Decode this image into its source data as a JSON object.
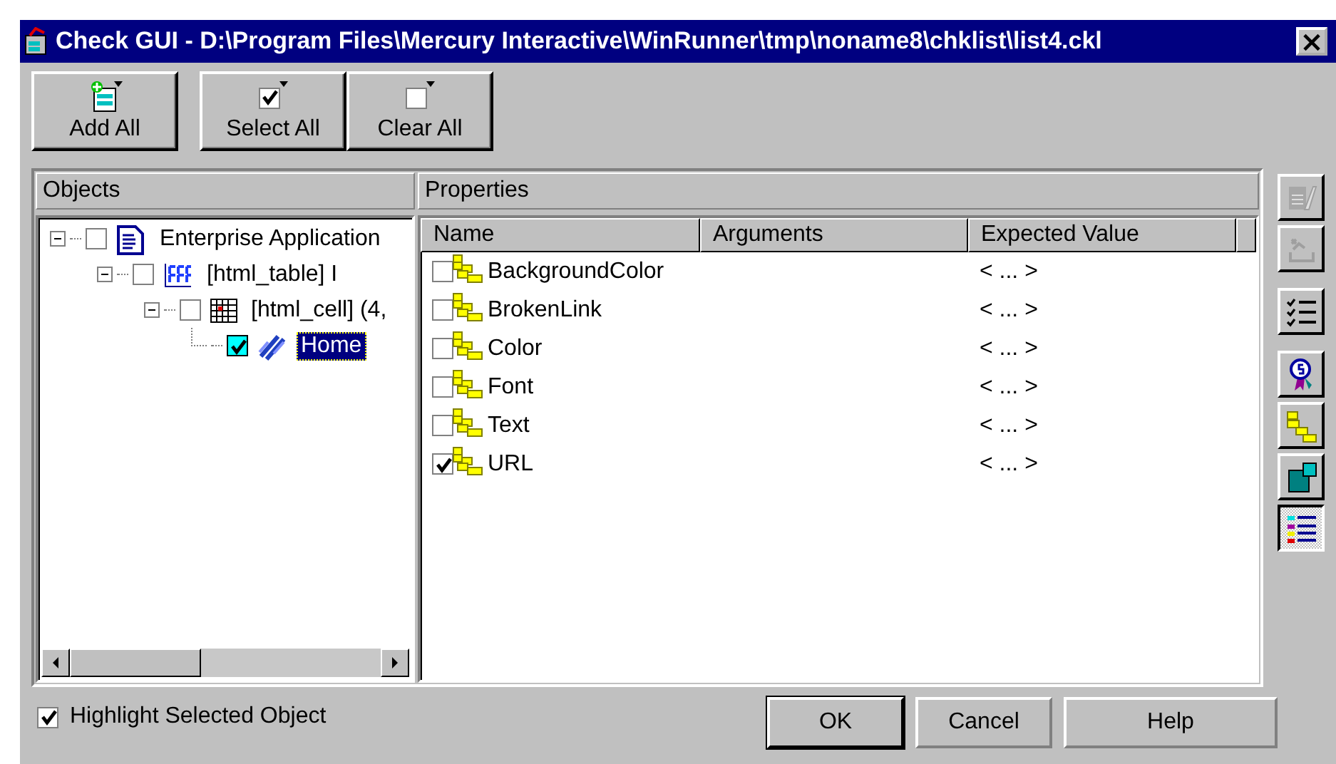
{
  "window": {
    "title": "Check GUI - D:\\Program Files\\Mercury Interactive\\WinRunner\\tmp\\noname8\\chklist\\list4.ckl",
    "close": "×"
  },
  "toolbar": [
    {
      "kind": "add",
      "label": "Add All"
    },
    {
      "kind": "check",
      "label": "Select All"
    },
    {
      "kind": "clear",
      "label": "Clear All"
    }
  ],
  "objects": {
    "title": "Objects",
    "tree": [
      {
        "kind": "doc",
        "label": "Enterprise Application",
        "checked": false,
        "selected": false,
        "expanded": true,
        "children": [
          {
            "kind": "table",
            "label": "[html_table] I",
            "checked": false,
            "selected": false,
            "expanded": true,
            "children": [
              {
                "kind": "cell",
                "label": "[html_cell] (4,",
                "checked": false,
                "selected": false,
                "expanded": true,
                "children": [
                  {
                    "kind": "link",
                    "label": "Home",
                    "checked": true,
                    "selected": true
                  }
                ]
              }
            ]
          }
        ]
      }
    ]
  },
  "properties": {
    "title": "Properties",
    "columns": [
      "Name",
      "Arguments",
      "Expected Value"
    ],
    "rows": [
      {
        "name": "BackgroundColor",
        "checked": false,
        "expected": "< ... >"
      },
      {
        "name": "BrokenLink",
        "checked": false,
        "expected": "< ... >"
      },
      {
        "name": "Color",
        "checked": false,
        "expected": "< ... >"
      },
      {
        "name": "Font",
        "checked": false,
        "expected": "< ... >"
      },
      {
        "name": "Text",
        "checked": false,
        "expected": "< ... >"
      },
      {
        "name": "URL",
        "checked": true,
        "expected": "< ... >"
      }
    ]
  },
  "side_buttons": [
    {
      "kind": "edit",
      "disabled": true,
      "selected": false
    },
    {
      "kind": "args",
      "disabled": true,
      "selected": false
    },
    {
      "kind": "list",
      "disabled": false,
      "selected": false
    },
    {
      "kind": "award",
      "disabled": false,
      "selected": false
    },
    {
      "kind": "bricks",
      "disabled": false,
      "selected": false
    },
    {
      "kind": "square",
      "disabled": false,
      "selected": false
    },
    {
      "kind": "details",
      "disabled": false,
      "selected": true
    }
  ],
  "highlight": {
    "label": "Highlight Selected Object",
    "checked": true
  },
  "buttons": [
    "OK",
    "Cancel",
    "Help"
  ]
}
